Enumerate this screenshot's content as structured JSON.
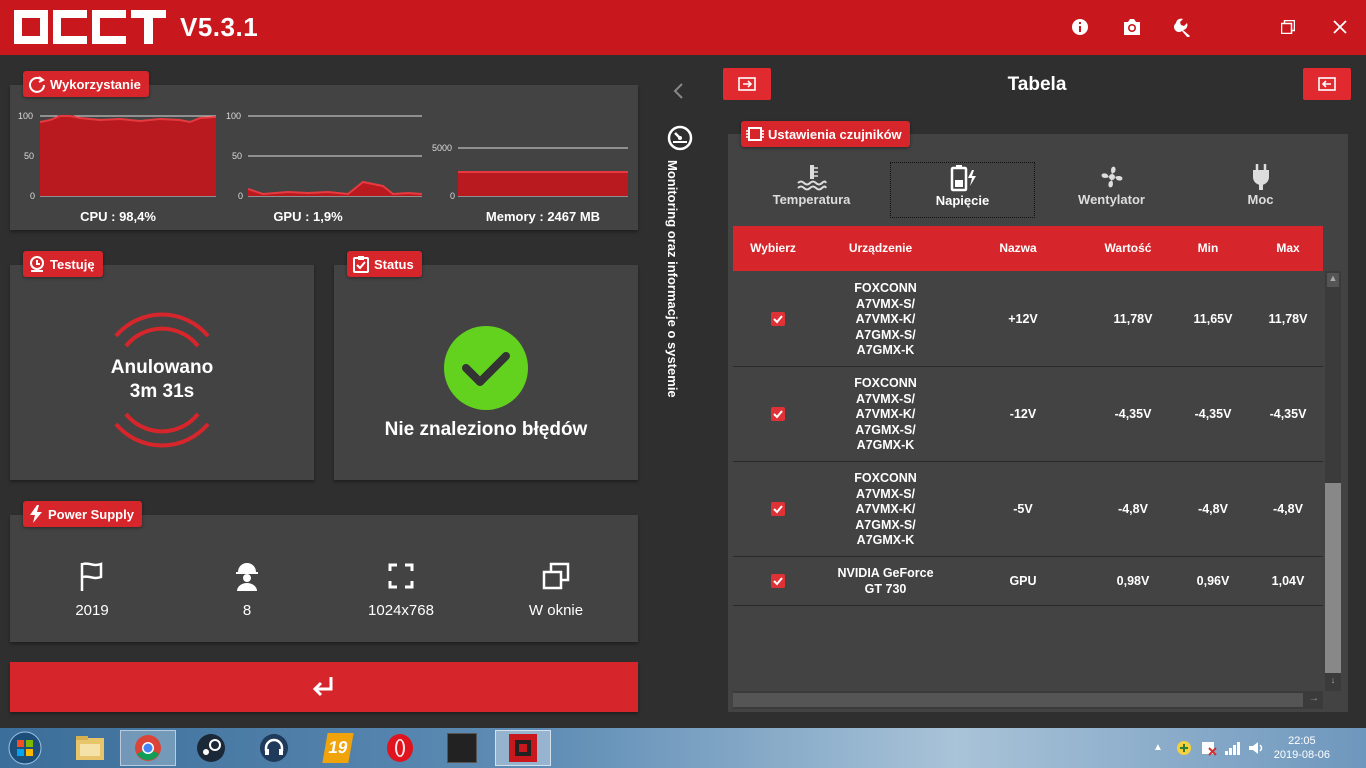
{
  "app": {
    "version": "V5.3.1"
  },
  "usage": {
    "title": "Wykorzystanie",
    "cpu": {
      "label": "CPU : 98,4%",
      "ticks": [
        "100",
        "50",
        "0"
      ]
    },
    "gpu": {
      "label": "GPU : 1,9%",
      "ticks": [
        "100",
        "50",
        "0"
      ]
    },
    "memory": {
      "label": "Memory : 2467 MB",
      "ticks": [
        "5000",
        "0"
      ]
    }
  },
  "testing": {
    "title": "Testuję",
    "state": "Anulowano",
    "time": "3m 31s"
  },
  "status": {
    "title": "Status",
    "message": "Nie znaleziono błędów"
  },
  "power_supply": {
    "title": "Power Supply",
    "items": [
      {
        "icon": "flag-icon",
        "value": "2019"
      },
      {
        "icon": "worker-icon",
        "value": "8"
      },
      {
        "icon": "fullscreen-icon",
        "value": "1024x768"
      },
      {
        "icon": "windows-icon",
        "value": "W oknie"
      }
    ]
  },
  "sidebar": {
    "vertical_label": "Monitoring oraz informacje o systemie"
  },
  "right": {
    "title": "Tabela",
    "sensor_settings_label": "Ustawienia czujników",
    "tabs": [
      {
        "label": "Temperatura",
        "icon": "temperature-icon"
      },
      {
        "label": "Napięcie",
        "icon": "battery-icon",
        "active": true
      },
      {
        "label": "Wentylator",
        "icon": "fan-icon"
      },
      {
        "label": "Moc",
        "icon": "plug-icon"
      }
    ],
    "table": {
      "headers": [
        "Wybierz",
        "Urządzenie",
        "Nazwa",
        "Wartość",
        "Min",
        "Max"
      ],
      "rows": [
        {
          "device": [
            "FOXCONN",
            "A7VMX-S/",
            "A7VMX-K/",
            "A7GMX-S/",
            "A7GMX-K"
          ],
          "name": "+12V",
          "value": "11,78V",
          "min": "11,65V",
          "max": "11,78V",
          "checked": true
        },
        {
          "device": [
            "FOXCONN",
            "A7VMX-S/",
            "A7VMX-K/",
            "A7GMX-S/",
            "A7GMX-K"
          ],
          "name": "-12V",
          "value": "-4,35V",
          "min": "-4,35V",
          "max": "-4,35V",
          "checked": true
        },
        {
          "device": [
            "FOXCONN",
            "A7VMX-S/",
            "A7VMX-K/",
            "A7GMX-S/",
            "A7GMX-K"
          ],
          "name": "-5V",
          "value": "-4,8V",
          "min": "-4,8V",
          "max": "-4,8V",
          "checked": true
        },
        {
          "device": [
            "NVIDIA GeForce",
            "GT 730"
          ],
          "name": "GPU",
          "value": "0,98V",
          "min": "0,96V",
          "max": "1,04V",
          "checked": true
        }
      ]
    }
  },
  "taskbar": {
    "time": "22:05",
    "date": "2019-08-06",
    "badge_19": "19"
  },
  "colors": {
    "accent": "#c8181e",
    "panel": "#434343",
    "background": "#2f2f2f",
    "ok_green": "#63d21f"
  }
}
